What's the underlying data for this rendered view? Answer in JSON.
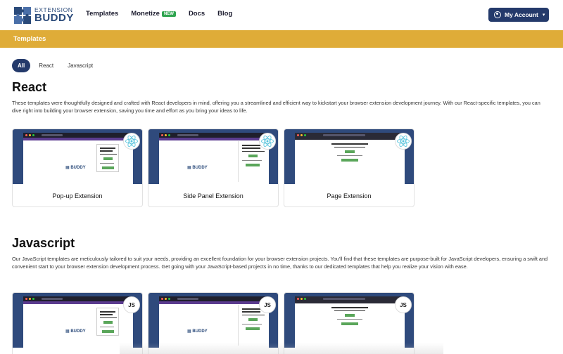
{
  "nav": {
    "logo_top": "EXTENSION",
    "logo_bottom": "BUDDY",
    "links": [
      {
        "label": "Templates"
      },
      {
        "label": "Monetize",
        "badge": "NEW"
      },
      {
        "label": "Docs"
      },
      {
        "label": "Blog"
      }
    ],
    "account_label": "My Account"
  },
  "banner": {
    "title": "Templates"
  },
  "filters": [
    "All",
    "React",
    "Javascript"
  ],
  "react": {
    "title": "React",
    "description": "These templates were thoughtfully designed and crafted with React developers in mind, offering you a streamlined and efficient way to kickstart your browser extension development journey. With our React-specific templates, you can dive right into building your browser extension, saving you time and effort as you bring your ideas to life.",
    "cards": [
      {
        "label": "Pop-up Extension",
        "icon": "react-icon"
      },
      {
        "label": "Side Panel Extension",
        "icon": "react-icon"
      },
      {
        "label": "Page Extension",
        "icon": "react-icon"
      }
    ]
  },
  "javascript": {
    "title": "Javascript",
    "description": "Our JavaScript templates are meticulously tailored to suit your needs, providing an excellent foundation for your browser extension projects. You'll find that these templates are purpose-built for JavaScript developers, ensuring a swift and convenient start to your browser extension development process. Get going with your JavaScript-based projects in no time, thanks to our dedicated templates that help you realize your vision with ease.",
    "badge_text": "JS"
  },
  "colors": {
    "nav_button": "#243a6b",
    "banner": "#dfac38",
    "thumb_bg": "#2f4a7c",
    "new_badge": "#2ea44f"
  }
}
